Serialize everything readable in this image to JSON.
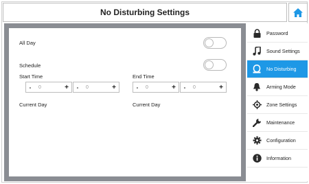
{
  "header": {
    "title": "No Disturbing Settings"
  },
  "settings": {
    "all_day_label": "All Day",
    "schedule_label": "Schedule",
    "start_time_label": "Start Time",
    "end_time_label": "End Time",
    "current_day_label_start": "Current Day",
    "current_day_label_end": "Current Day",
    "start_hour": {
      "minus": "-",
      "value": "0",
      "plus": "+"
    },
    "start_minute": {
      "minus": "-",
      "value": "0",
      "plus": "+"
    },
    "end_hour": {
      "minus": "-",
      "value": "0",
      "plus": "+"
    },
    "end_minute": {
      "minus": "-",
      "value": "0",
      "plus": "+"
    }
  },
  "sidebar": {
    "items": [
      {
        "label": "Password",
        "icon": "lock-icon"
      },
      {
        "label": "Sound Settings",
        "icon": "music-note-icon"
      },
      {
        "label": "No Disturbing",
        "icon": "no-disturb-icon",
        "active": true
      },
      {
        "label": "Arming Mode",
        "icon": "bell-icon"
      },
      {
        "label": "Zone Settings",
        "icon": "crosshair-icon"
      },
      {
        "label": "Maintenance",
        "icon": "wrench-icon"
      },
      {
        "label": "Configuration",
        "icon": "gear-icon"
      },
      {
        "label": "Information",
        "icon": "info-icon"
      }
    ]
  },
  "colors": {
    "accent": "#1e98e6",
    "panel_border": "#8a8d93"
  }
}
